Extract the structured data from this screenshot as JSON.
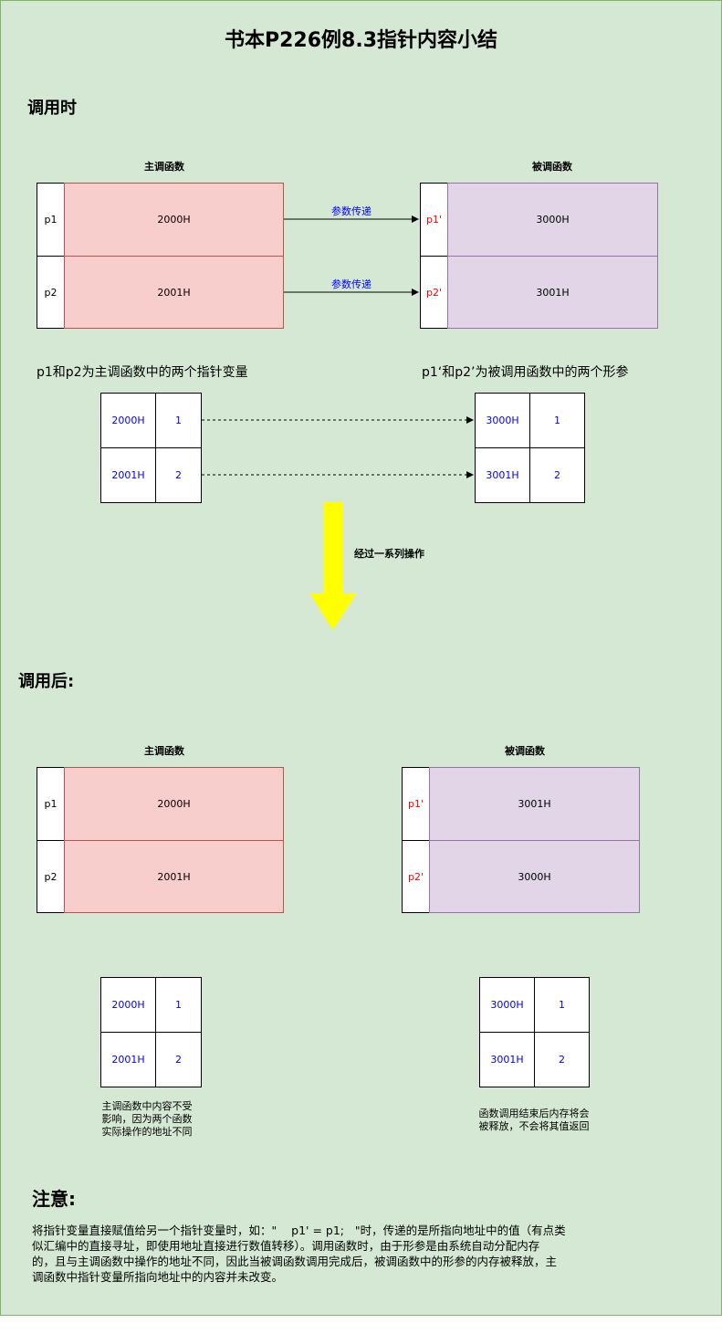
{
  "title": "书本P226例8.3指针内容小结",
  "before": {
    "heading": "调用时",
    "main_caption": "主调函数",
    "callee_caption": "被调函数",
    "main_rows": [
      {
        "label": "p1",
        "value": "2000H"
      },
      {
        "label": "p2",
        "value": "2001H"
      }
    ],
    "callee_rows": [
      {
        "label": "p1'",
        "value": "3000H"
      },
      {
        "label": "p2'",
        "value": "3001H"
      }
    ],
    "arrow_label_1": "参数传递",
    "arrow_label_2": "参数传递",
    "main_desc": "p1和p2为主调函数中的两个指针变量",
    "callee_desc": "p1‘和p2’为被调用函数中的两个形参",
    "main_mem": [
      {
        "addr": "2000H",
        "val": "1"
      },
      {
        "addr": "2001H",
        "val": "2"
      }
    ],
    "callee_mem": [
      {
        "addr": "3000H",
        "val": "1"
      },
      {
        "addr": "3001H",
        "val": "2"
      }
    ]
  },
  "transition": {
    "label": "经过一系列操作",
    "arrow_color": "#ffff00"
  },
  "after": {
    "heading": "调用后:",
    "main_caption": "主调函数",
    "callee_caption": "被调函数",
    "main_rows": [
      {
        "label": "p1",
        "value": "2000H"
      },
      {
        "label": "p2",
        "value": "2001H"
      }
    ],
    "callee_rows": [
      {
        "label": "p1'",
        "value": "3001H"
      },
      {
        "label": "p2'",
        "value": "3000H"
      }
    ],
    "main_mem": [
      {
        "addr": "2000H",
        "val": "1"
      },
      {
        "addr": "2001H",
        "val": "2"
      }
    ],
    "callee_mem": [
      {
        "addr": "3000H",
        "val": "1"
      },
      {
        "addr": "3001H",
        "val": "2"
      }
    ],
    "main_note_lines": [
      "主调函数中内容不受",
      "影响，因为两个函数",
      "实际操作的地址不同"
    ],
    "callee_note_lines": [
      "函数调用结束后内存将会",
      "被释放，不会将其值返回"
    ]
  },
  "note": {
    "heading": "注意:",
    "lines": [
      "将指针变量直接赋值给另一个指针变量时，如：\"    p1' = p1;   \"时，传递的是所指向地址中的值（有点类",
      "似汇编中的直接寻址，即使用地址直接进行数值转移）。调用函数时，由于形参是由系统自动分配内存",
      "的，且与主调函数中操作的地址不同，因此当被调函数调用完成后，被调函数中的形参的内存被释放，主",
      "调函数中指针变量所指向地址中的内容并未改变。"
    ]
  },
  "colors": {
    "background": "#d5e8d4",
    "main_fill": "#f8cecc",
    "callee_fill": "#e1d5e7",
    "address_text": "#0000ff",
    "param_label_text": "#ff0000"
  }
}
